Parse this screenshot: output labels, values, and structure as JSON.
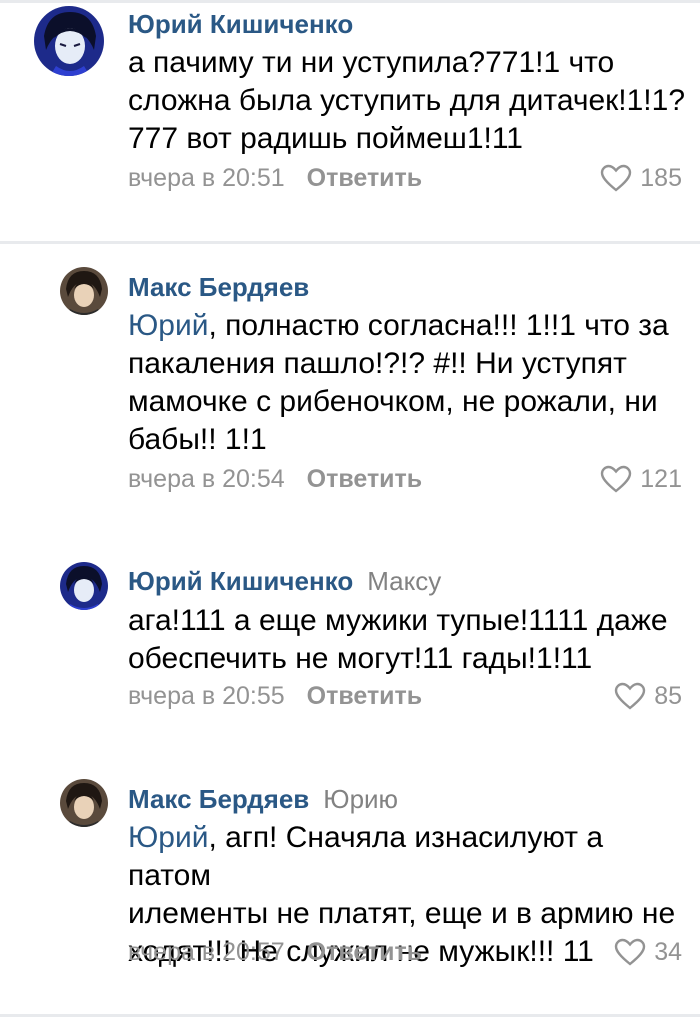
{
  "comments": [
    {
      "author": "Юрий Кишиченко",
      "reply_to": "",
      "mention": "",
      "text": "а пачиму ти ни уступила?771!1 что\nсложна была уступить для дитачек!1!1?\n777 вот радишь поймеш1!11",
      "time": "вчера в 20:51",
      "reply_label": "Ответить",
      "likes": "185",
      "avatar": "anime-boy-blue"
    },
    {
      "author": "Макс Бердяев",
      "reply_to": "",
      "mention": "Юрий",
      "text": ", полнастю согласна!!! 1!!1 что за\nпакаления пашло!?!? #!! Ни уступят\nмамочке с рибеночком, не рожали, ни\nбабы!! 1!1",
      "time": "вчера в 20:54",
      "reply_label": "Ответить",
      "likes": "121",
      "avatar": "anime-boy-dark"
    },
    {
      "author": "Юрий Кишиченко",
      "reply_to": "Максу",
      "mention": "",
      "text": "ага!111 а еще мужики тупые!1111 даже\nобеспечить не могут!11 гады!1!11",
      "time": "вчера в 20:55",
      "reply_label": "Ответить",
      "likes": "85",
      "avatar": "anime-boy-blue"
    },
    {
      "author": "Макс Бердяев",
      "reply_to": "Юрию",
      "mention": "Юрий",
      "text": ", агп! Сначяла изнасилуют а патом\nилементы не платят, еще и в армию не\nходят!!! Не служил не мужык!!! 11",
      "time": "вчера в 20:57",
      "reply_label": "Ответить",
      "likes": "34",
      "avatar": "anime-boy-dark"
    }
  ],
  "colors": {
    "author": "#2a5885",
    "meta": "#939393",
    "divider": "#e8eaed"
  },
  "icons": {
    "like": "heart-outline-icon"
  }
}
